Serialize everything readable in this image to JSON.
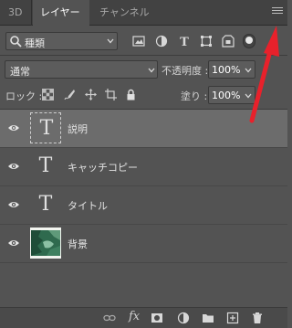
{
  "tabs": [
    {
      "label": "3D"
    },
    {
      "label": "レイヤー"
    },
    {
      "label": "チャンネル"
    }
  ],
  "filter": {
    "kind_label": "種類"
  },
  "blend": {
    "mode": "通常",
    "opacity_label": "不透明度 :",
    "opacity_value": "100%"
  },
  "lock": {
    "label": "ロック :",
    "fill_label": "塗り :",
    "fill_value": "100%"
  },
  "layers": [
    {
      "name": "説明",
      "type": "text",
      "selected": true
    },
    {
      "name": "キャッチコピー",
      "type": "text",
      "selected": false
    },
    {
      "name": "タイトル",
      "type": "text",
      "selected": false
    },
    {
      "name": "背景",
      "type": "image",
      "selected": false
    }
  ],
  "colors": {
    "panel": "#535353",
    "tabbar": "#424242",
    "selected_row": "#6c6c6c",
    "annotation_arrow": "#e8212b"
  }
}
